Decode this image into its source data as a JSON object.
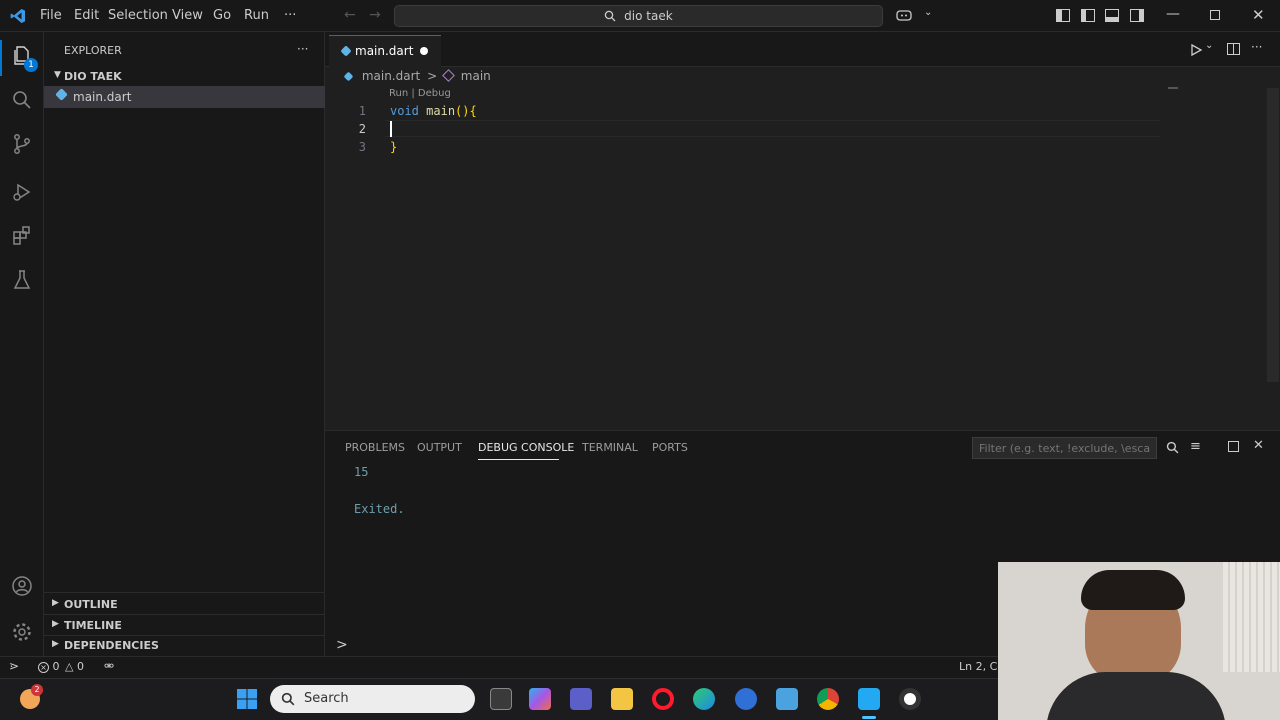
{
  "menu": {
    "file": "File",
    "edit": "Edit",
    "selection": "Selection",
    "view": "View",
    "go": "Go",
    "run": "Run",
    "more": "···"
  },
  "search": {
    "text": "dio taek"
  },
  "explorer": {
    "title": "EXPLORER",
    "more": "···",
    "folder": "DIO TAEK",
    "file": "main.dart"
  },
  "sidebar_sections": {
    "outline": "OUTLINE",
    "timeline": "TIMELINE",
    "dependencies": "DEPENDENCIES"
  },
  "activity_badge": "1",
  "editor": {
    "tab_label": "main.dart",
    "breadcrumb_file": "main.dart",
    "breadcrumb_sep": ">",
    "breadcrumb_symbol": "main",
    "codelens": "Run | Debug",
    "line_numbers": [
      "1",
      "2",
      "3"
    ],
    "line1_keyword": "void",
    "line1_fn": "main",
    "line1_rest": "(){",
    "line3": "}"
  },
  "panel": {
    "tabs": [
      "PROBLEMS",
      "OUTPUT",
      "DEBUG CONSOLE",
      "TERMINAL",
      "PORTS"
    ],
    "active_tab": "DEBUG CONSOLE",
    "filter_placeholder": "Filter (e.g. text, !exclude, \\esca...",
    "output_lines": [
      "15",
      "Exited."
    ],
    "prompt": ">"
  },
  "status": {
    "errors": "0",
    "warnings": "0",
    "position": "Ln 2, Co"
  },
  "taskbar": {
    "search_label": "Search",
    "notification_count": "2"
  },
  "colors": {
    "accent": "#0078d4",
    "keyword": "#569cd6",
    "function": "#dcdcaa",
    "output_text": "#6d9eac",
    "tab_dot": "#ffffff"
  }
}
